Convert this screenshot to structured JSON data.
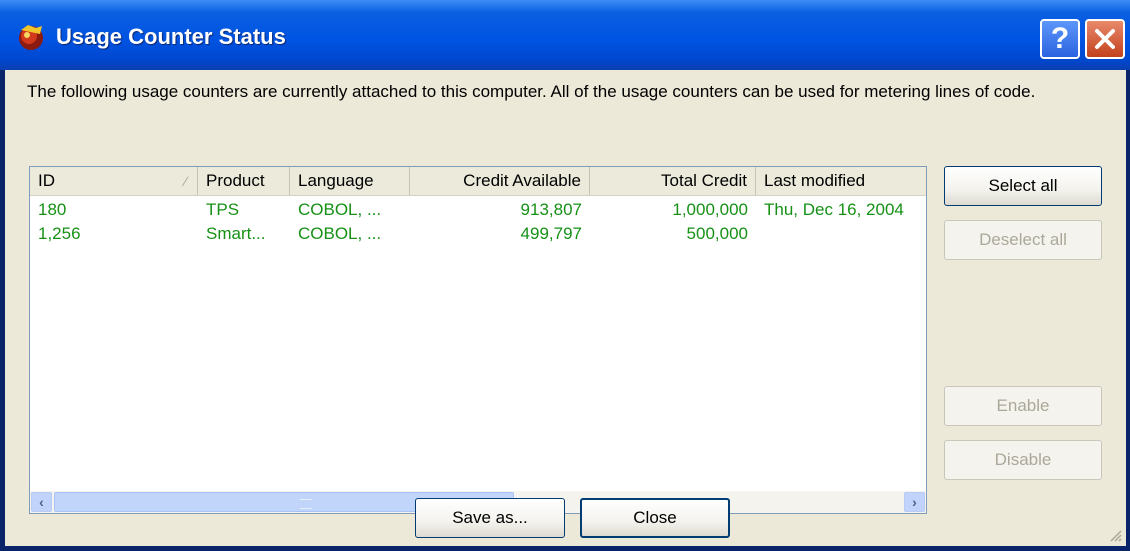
{
  "window": {
    "title": "Usage Counter Status",
    "help_label": "?",
    "close_icon": "close-icon"
  },
  "description": "The following usage counters are currently attached to this computer. All of the usage counters can be used for metering lines of code.",
  "table": {
    "columns": [
      "ID",
      "Product",
      "Language",
      "Credit Available",
      "Total Credit",
      "Last modified"
    ],
    "rows": [
      [
        "180",
        "TPS",
        "COBOL, ...",
        "913,807",
        "1,000,000",
        "Thu, Dec 16, 2004"
      ],
      [
        "1,256",
        "Smart...",
        "COBOL, ...",
        "499,797",
        "500,000",
        ""
      ]
    ],
    "text_color": "#169116"
  },
  "buttons": {
    "select_all": "Select all",
    "deselect_all": "Deselect all",
    "enable": "Enable",
    "disable": "Disable",
    "save_as": "Save as...",
    "close": "Close"
  },
  "colors": {
    "titlebar": "#0054e3",
    "dialog_bg": "#ece9d8",
    "list_row_text": "#169116"
  }
}
